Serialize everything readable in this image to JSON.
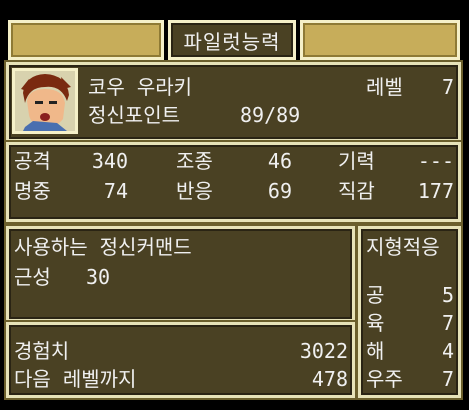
{
  "title": "파일럿능력",
  "pilot": {
    "name": "코우 우라키",
    "level_label": "레벨",
    "level_value": "7",
    "sp_label": "정신포인트",
    "sp_value": "89/89"
  },
  "stats": [
    {
      "label": "공격",
      "value": "340"
    },
    {
      "label": "조종",
      "value": "46"
    },
    {
      "label": "기력",
      "value": "---"
    },
    {
      "label": "명중",
      "value": "74"
    },
    {
      "label": "반응",
      "value": "69"
    },
    {
      "label": "직감",
      "value": "177"
    }
  ],
  "spirit": {
    "header": "사용하는 정신커맨드",
    "commands": [
      {
        "name": "근성",
        "cost": "30"
      }
    ]
  },
  "terrain": {
    "header": "지형적응",
    "rows": [
      {
        "label": "공",
        "value": "5"
      },
      {
        "label": "육",
        "value": "7"
      },
      {
        "label": "해",
        "value": "4"
      },
      {
        "label": "우주",
        "value": "7"
      }
    ]
  },
  "exp": {
    "exp_label": "경험치",
    "exp_value": "3022",
    "next_label": "다음 레벨까지",
    "next_value": "478"
  }
}
